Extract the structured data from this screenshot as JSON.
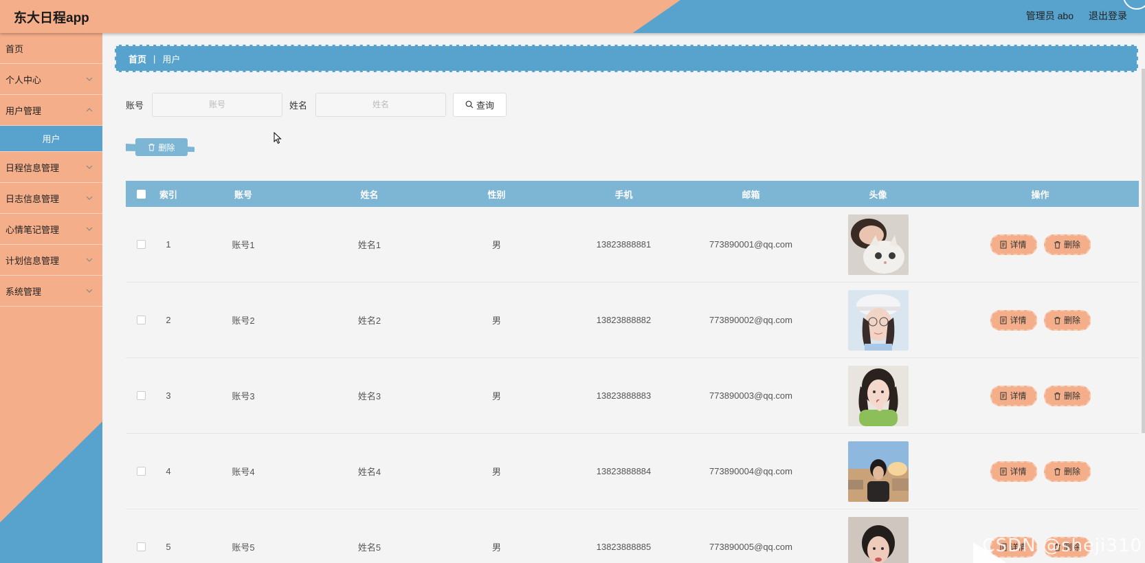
{
  "header": {
    "app_title": "东大日程app",
    "user_label": "管理员 abo",
    "logout_label": "退出登录"
  },
  "sidebar": {
    "items": [
      {
        "label": "首页"
      },
      {
        "label": "个人中心"
      },
      {
        "label": "用户管理"
      },
      {
        "label": "用户"
      },
      {
        "label": "日程信息管理"
      },
      {
        "label": "日志信息管理"
      },
      {
        "label": "心情笔记管理"
      },
      {
        "label": "计划信息管理"
      },
      {
        "label": "系统管理"
      }
    ]
  },
  "breadcrumb": {
    "home": "首页",
    "separator": "|",
    "current": "用户"
  },
  "search": {
    "account_label": "账号",
    "account_placeholder": "账号",
    "name_label": "姓名",
    "name_placeholder": "姓名",
    "query_label": "查询"
  },
  "toolbar": {
    "delete_label": "删除"
  },
  "table": {
    "headers": [
      "索引",
      "账号",
      "姓名",
      "性别",
      "手机",
      "邮箱",
      "头像",
      "操作"
    ],
    "rows": [
      {
        "idx": "1",
        "account": "账号1",
        "name": "姓名1",
        "sex": "男",
        "phone": "13823888881",
        "email": "773890001@qq.com"
      },
      {
        "idx": "2",
        "account": "账号2",
        "name": "姓名2",
        "sex": "男",
        "phone": "13823888882",
        "email": "773890002@qq.com"
      },
      {
        "idx": "3",
        "account": "账号3",
        "name": "姓名3",
        "sex": "男",
        "phone": "13823888883",
        "email": "773890003@qq.com"
      },
      {
        "idx": "4",
        "account": "账号4",
        "name": "姓名4",
        "sex": "男",
        "phone": "13823888884",
        "email": "773890004@qq.com"
      },
      {
        "idx": "5",
        "account": "账号5",
        "name": "姓名5",
        "sex": "男",
        "phone": "13823888885",
        "email": "773890005@qq.com"
      }
    ],
    "detail_label": "详情",
    "row_delete_label": "删除"
  },
  "watermark": "CSDN @sheji310",
  "colors": {
    "peach": "#f5ae8a",
    "blue": "#57a3cd",
    "table_head": "#7db5d4"
  }
}
